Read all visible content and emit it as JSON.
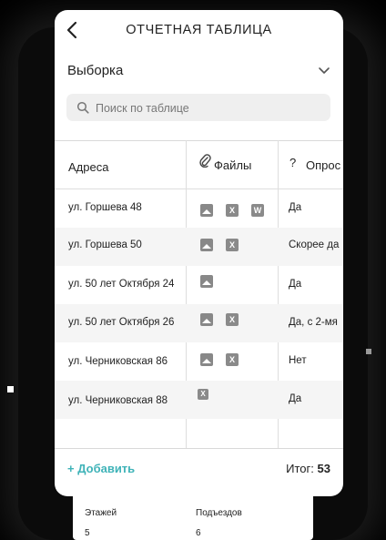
{
  "header": {
    "title": "ОТЧЕТНАЯ ТАБЛИЦА"
  },
  "filter": {
    "label": "Выборка"
  },
  "search": {
    "placeholder": "Поиск по таблице"
  },
  "table": {
    "columns": {
      "address": "Адреса",
      "files": "Файлы",
      "survey": "Опрос"
    },
    "rows": [
      {
        "address": "ул. Горшева 48",
        "survey": "Да"
      },
      {
        "address": "ул. Горшева 50",
        "survey": "Скорее да"
      },
      {
        "address": "ул. 50 лет Октября 24",
        "survey": "Да"
      },
      {
        "address": "ул. 50 лет Октября 26",
        "survey": "Да, с 2-мя"
      },
      {
        "address": "ул. Черниковская 86",
        "survey": "Нет"
      },
      {
        "address": "ул. Черниковская 88",
        "survey": "Да"
      }
    ],
    "file_icons": {
      "x": "X",
      "w": "W"
    }
  },
  "footer": {
    "add_label": "+ Добавить",
    "total_label": "Итог:",
    "total_value": "53"
  },
  "under_sheet": {
    "floors_label": "Этажей",
    "entrances_label": "Подъездов",
    "floors_value": "5",
    "entrances_value": "6"
  },
  "colors": {
    "accent": "#3fb3b8",
    "alt_row": "#f5f5f5",
    "icon_gray": "#888888"
  }
}
